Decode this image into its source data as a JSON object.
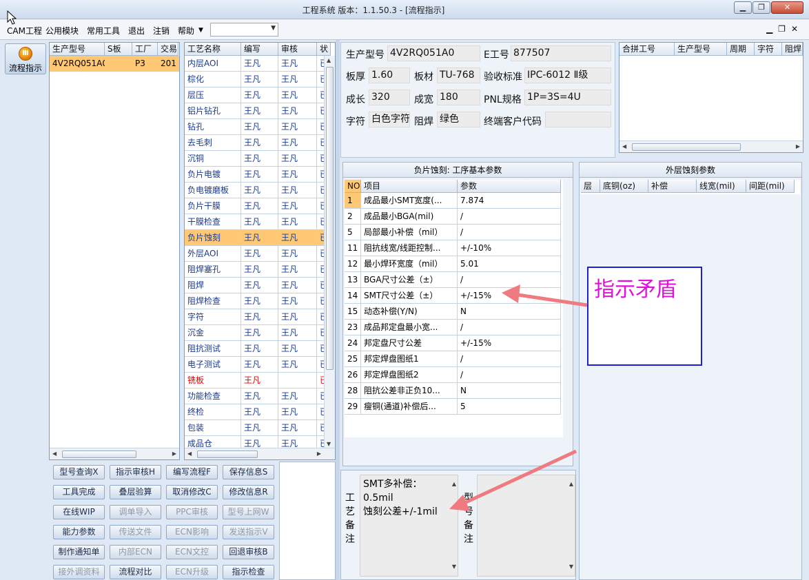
{
  "window": {
    "title": "工程系统   版本：1.1.50.3 - [流程指示]",
    "minimize": "▁",
    "restore": "❐",
    "close": "✕"
  },
  "menu": {
    "items": [
      "CAM工程",
      "公用模块",
      "常用工具",
      "退出",
      "注销",
      "帮助"
    ],
    "combo_value": "",
    "mdi_controls": "▁❐✕"
  },
  "sidebar": {
    "flow_button": "流程指示",
    "flow_icon": "circle-icon"
  },
  "order_table": {
    "columns": [
      "生产型号",
      "S板",
      "工厂",
      "交易"
    ],
    "rows": [
      [
        "4V2RQ051A0",
        "",
        "P3",
        "201"
      ]
    ]
  },
  "process_table": {
    "columns": [
      "工艺名称",
      "编写",
      "审核",
      "状"
    ],
    "rows": [
      [
        "内层AOI",
        "王凡",
        "王凡",
        "已"
      ],
      [
        "棕化",
        "王凡",
        "王凡",
        "已"
      ],
      [
        "层压",
        "王凡",
        "王凡",
        "已"
      ],
      [
        "铝片钻孔",
        "王凡",
        "王凡",
        "已"
      ],
      [
        "钻孔",
        "王凡",
        "王凡",
        "已"
      ],
      [
        "去毛刺",
        "王凡",
        "王凡",
        "已"
      ],
      [
        "沉铜",
        "王凡",
        "王凡",
        "已"
      ],
      [
        "负片电镀",
        "王凡",
        "王凡",
        "已"
      ],
      [
        "负电镀磨板",
        "王凡",
        "王凡",
        "已"
      ],
      [
        "负片干膜",
        "王凡",
        "王凡",
        "已"
      ],
      [
        "干膜检查",
        "王凡",
        "王凡",
        "已"
      ],
      [
        "负片蚀刻",
        "王凡",
        "王凡",
        "已"
      ],
      [
        "外层AOI",
        "王凡",
        "王凡",
        "已"
      ],
      [
        "阻焊塞孔",
        "王凡",
        "王凡",
        "已"
      ],
      [
        "阻焊",
        "王凡",
        "王凡",
        "已"
      ],
      [
        "阻焊检查",
        "王凡",
        "王凡",
        "已"
      ],
      [
        "字符",
        "王凡",
        "王凡",
        "已"
      ],
      [
        "沉金",
        "王凡",
        "王凡",
        "已"
      ],
      [
        "阻抗测试",
        "王凡",
        "王凡",
        "已"
      ],
      [
        "电子测试",
        "王凡",
        "王凡",
        "已"
      ],
      [
        "铣板",
        "王凡",
        "",
        "已"
      ],
      [
        "功能检查",
        "王凡",
        "王凡",
        "已"
      ],
      [
        "终检",
        "王凡",
        "王凡",
        "已"
      ],
      [
        "包装",
        "王凡",
        "王凡",
        "已"
      ],
      [
        "成品仓",
        "王凡",
        "王凡",
        "已"
      ]
    ],
    "selected_index": 11,
    "red_index": 20
  },
  "buttons": [
    [
      "型号查询X",
      "指示审核H",
      "编写流程F",
      "保存信息S"
    ],
    [
      "工具完成",
      "叠层验算",
      "取消修改C",
      "修改信息R"
    ],
    [
      "在线WIP",
      "调单导入",
      "PPC审核",
      "型号上网W"
    ],
    [
      "能力参数",
      "传送文件",
      "ECN影响",
      "发送指示V"
    ],
    [
      "制作通知单",
      "内部ECN",
      "ECN文控",
      "回退审核B"
    ],
    [
      "接外调资料",
      "流程对比",
      "ECN升级",
      "指示检查"
    ]
  ],
  "disabled_buttons": [
    "调单导入",
    "PPC审核",
    "型号上网W",
    "传送文件",
    "ECN影响",
    "发送指示V",
    "内部ECN",
    "ECN文控",
    "接外调资料",
    "ECN升级"
  ],
  "info": {
    "model_label": "生产型号",
    "model": "4V2RQ051A0",
    "eno_label": "E工号",
    "eno": "877507",
    "thick_label": "板厚",
    "thick": "1.60",
    "material_label": "板材",
    "material": "TU-768",
    "standard_label": "验收标准",
    "standard": "IPC-6012 Ⅱ级",
    "len_label": "成长",
    "len": "320",
    "wid_label": "成宽",
    "wid": "180",
    "pnl_label": "PNL规格",
    "pnl": "1P=3S=4U",
    "char_label": "字符",
    "char": "白色字符",
    "mask_label": "阻焊",
    "mask": "绿色",
    "cust_label": "终端客户代码",
    "cust": ""
  },
  "merge_table": {
    "columns": [
      "合拼工号",
      "生产型号",
      "周期",
      "字符",
      "阻焊"
    ]
  },
  "etch_params": {
    "title": "负片蚀刻: 工序基本参数",
    "columns": [
      "NO",
      "项目",
      "参数"
    ],
    "rows": [
      [
        "1",
        "成品最小SMT宽度(...",
        "7.874"
      ],
      [
        "2",
        "成品最小BGA(mil)",
        "/"
      ],
      [
        "5",
        "局部最小补偿（mil）",
        "/"
      ],
      [
        "11",
        "阻抗线宽/线距控制...",
        "+/-10%"
      ],
      [
        "12",
        "最小焊环宽度（mil）",
        "5.01"
      ],
      [
        "13",
        "BGA尺寸公差（±）",
        "/"
      ],
      [
        "14",
        "SMT尺寸公差（±）",
        "+/-15%"
      ],
      [
        "15",
        "动态补偿(Y/N)",
        "N"
      ],
      [
        "23",
        "成品邦定盘最小宽...",
        "/"
      ],
      [
        "24",
        "邦定盘尺寸公差",
        "+/-15%"
      ],
      [
        "25",
        "邦定焊盘图纸1",
        "/"
      ],
      [
        "26",
        "邦定焊盘图纸2",
        "/"
      ],
      [
        "28",
        "阻抗公差非正负10...",
        "N"
      ],
      [
        "29",
        "瘦铜(通道)补偿后...",
        "5"
      ]
    ]
  },
  "outer_params": {
    "title": "外层蚀刻参数",
    "columns": [
      "层",
      "底铜(oz)",
      "补偿",
      "线宽(mil)",
      "间距(mil)"
    ]
  },
  "remarks": {
    "process_label": "工艺备注",
    "process_lines": [
      "SMT多补偿：",
      "0.5mil",
      "蚀刻公差+/-1mil"
    ],
    "model_label": "型号备注",
    "model_text": ""
  },
  "annotation": {
    "text": "指示矛盾",
    "color": "#e010d8",
    "border": "#1a22d0",
    "arrow_color": "#ef7a80"
  }
}
